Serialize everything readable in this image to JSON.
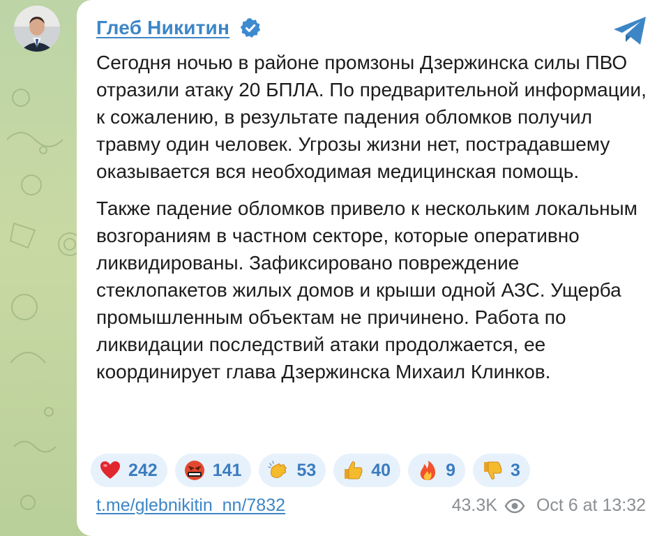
{
  "post": {
    "author": "Глеб Никитин",
    "paragraphs": [
      "Сегодня ночью в районе промзоны Дзержинска силы ПВО отразили атаку 20 БПЛА. По предварительной информации, к сожалению, в результате падения обломков получил травму один человек. Угрозы жизни нет, пострадавшему оказывается вся необходимая медицинская помощь.",
      "Также падение обломков привело к нескольким локальным возгораниям в частном секторе, которые оперативно ликвидированы. Зафиксировано повреждение стеклопакетов жилых домов и крыши одной АЗС. Ущерба промышленным объектам не причинено. Работа по ликвидации последствий атаки продолжается, ее координирует глава Дзержинска Михаил Клинков."
    ],
    "reactions": [
      {
        "emoji": "heart-icon",
        "count": "242"
      },
      {
        "emoji": "cursing-face-icon",
        "count": "141"
      },
      {
        "emoji": "clapping-hands-icon",
        "count": "53"
      },
      {
        "emoji": "thumbs-up-icon",
        "count": "40"
      },
      {
        "emoji": "fire-icon",
        "count": "9"
      },
      {
        "emoji": "thumbs-down-icon",
        "count": "3"
      }
    ],
    "link": "t.me/glebnikitin_nn/7832",
    "views": "43.3K",
    "timestamp": "Oct 6 at 13:32"
  },
  "colors": {
    "accent": "#3d86c6",
    "reaction_bg": "#e6f1fb",
    "background": "#c2d6a2"
  }
}
